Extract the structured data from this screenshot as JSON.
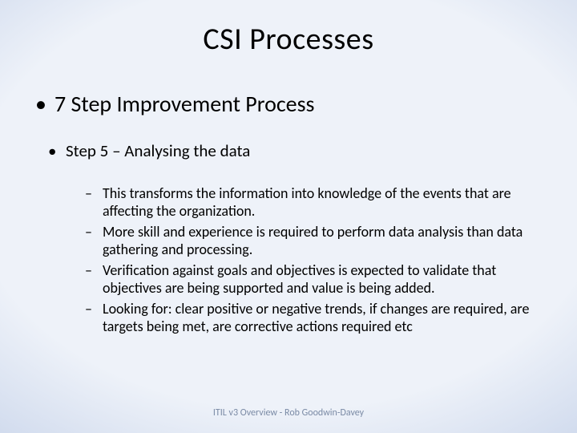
{
  "title": "CSI Processes",
  "level1": {
    "text": "7 Step Improvement Process"
  },
  "level2": {
    "text": "Step 5 – Analysing the data"
  },
  "level3": [
    {
      "text": "This transforms the information into knowledge of the events that are affecting the organization."
    },
    {
      "text": "More skill and experience is required to perform data analysis than data gathering and processing."
    },
    {
      "text": "Verification against goals and objectives is expected to validate that objectives are being supported and value is being added."
    },
    {
      "text": "Looking for: clear positive or negative trends, if changes are required, are targets being met, are corrective actions required etc"
    }
  ],
  "footer": "ITIL v3 Overview - Rob Goodwin-Davey",
  "bullets": {
    "dot": "•",
    "dash": "–"
  }
}
